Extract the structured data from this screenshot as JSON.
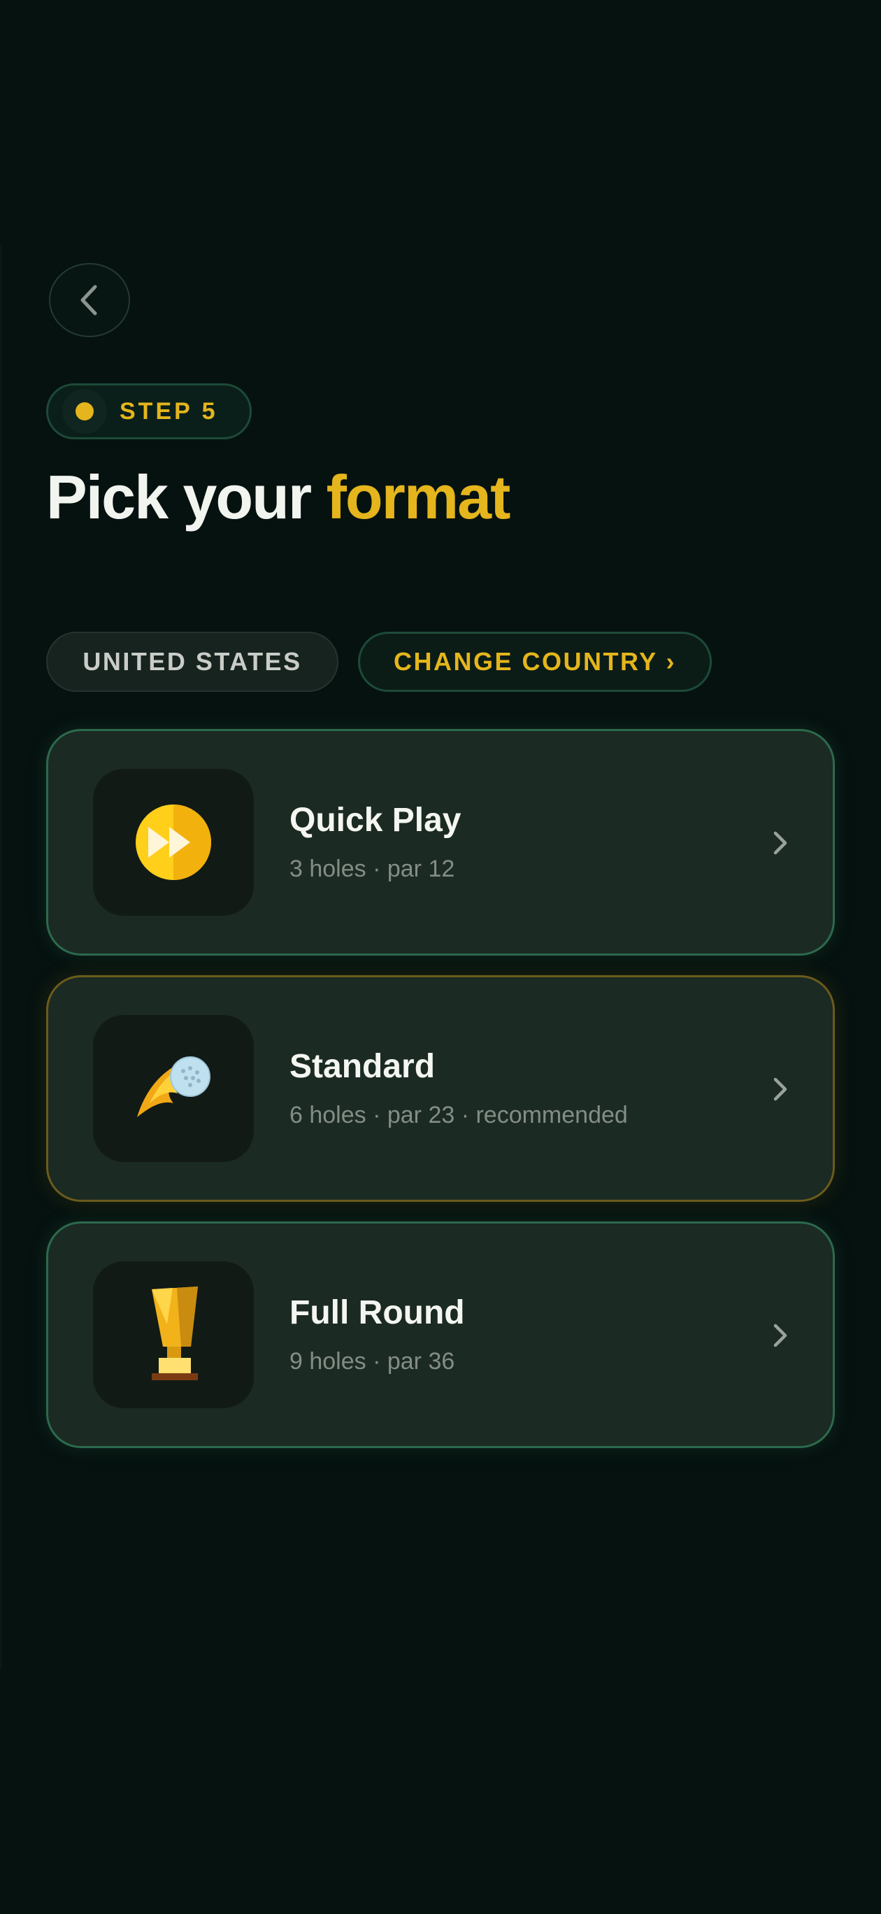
{
  "header": {
    "back_icon": "chevron-left-icon",
    "step_label": "STEP 5",
    "title_prefix": "Pick your ",
    "title_accent": "format"
  },
  "country": {
    "current": "UNITED STATES",
    "change_label": "CHANGE COUNTRY ›"
  },
  "formats": [
    {
      "title": "Quick Play",
      "subtitle": "3 holes · par 12",
      "icon": "fast-forward-icon"
    },
    {
      "title": "Standard",
      "subtitle": "6 holes · par 23 · recommended",
      "icon": "comet-golf-ball-icon"
    },
    {
      "title": "Full Round",
      "subtitle": "9 holes · par 36",
      "icon": "trophy-icon"
    }
  ],
  "colors": {
    "background": "#061210",
    "accent": "#e4b51c",
    "card": "#1b2a22",
    "card_border_green": "#2c6a4d",
    "card_border_gold": "#6b5b1c"
  }
}
